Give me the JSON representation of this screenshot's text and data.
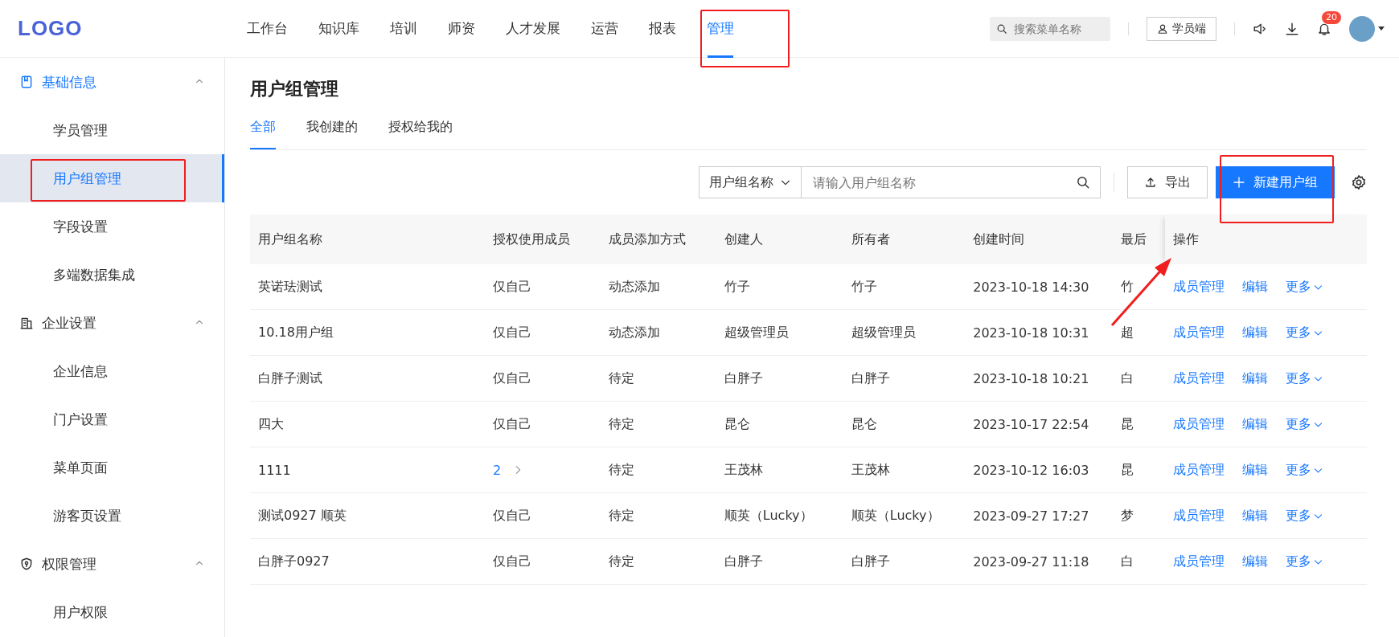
{
  "header": {
    "logo": "LOGO",
    "nav": [
      {
        "label": "工作台",
        "selected": false
      },
      {
        "label": "知识库",
        "selected": false
      },
      {
        "label": "培训",
        "selected": false
      },
      {
        "label": "师资",
        "selected": false
      },
      {
        "label": "人才发展",
        "selected": false
      },
      {
        "label": "运营",
        "selected": false
      },
      {
        "label": "报表",
        "selected": false
      },
      {
        "label": "管理",
        "selected": true
      }
    ],
    "search": {
      "placeholder": "搜索菜单名称"
    },
    "portal_button": "学员端",
    "notification_count": "20"
  },
  "sidebar": {
    "groups": [
      {
        "label": "基础信息",
        "expanded": true,
        "children": [
          {
            "label": "学员管理",
            "selected": false
          },
          {
            "label": "用户组管理",
            "selected": true
          },
          {
            "label": "字段设置",
            "selected": false
          },
          {
            "label": "多端数据集成",
            "selected": false
          }
        ]
      },
      {
        "label": "企业设置",
        "expanded": true,
        "children": [
          {
            "label": "企业信息",
            "selected": false
          },
          {
            "label": "门户设置",
            "selected": false
          },
          {
            "label": "菜单页面",
            "selected": false
          },
          {
            "label": "游客页设置",
            "selected": false
          }
        ]
      },
      {
        "label": "权限管理",
        "expanded": true,
        "children": [
          {
            "label": "用户权限",
            "selected": false
          }
        ]
      }
    ]
  },
  "page": {
    "title": "用户组管理",
    "tabs": [
      {
        "label": "全部",
        "selected": true
      },
      {
        "label": "我创建的",
        "selected": false
      },
      {
        "label": "授权给我的",
        "selected": false
      }
    ],
    "filter": {
      "field": "用户组名称",
      "placeholder": "请输入用户组名称"
    },
    "export_button": "导出",
    "create_button": "新建用户组"
  },
  "table": {
    "columns": [
      "用户组名称",
      "授权使用成员",
      "成员添加方式",
      "创建人",
      "所有者",
      "创建时间",
      "最后",
      "操作"
    ],
    "rows": [
      {
        "name": "英诺珐测试",
        "members": {
          "kind": "text",
          "text": "仅自己"
        },
        "add_method": "动态添加",
        "creator": "竹子",
        "owner": "竹子",
        "created": "2023-10-18 14:30",
        "last": "竹",
        "actions": [
          "成员管理",
          "编辑",
          "更多"
        ]
      },
      {
        "name": "10.18用户组",
        "members": {
          "kind": "text",
          "text": "仅自己"
        },
        "add_method": "动态添加",
        "creator": "超级管理员",
        "owner": "超级管理员",
        "created": "2023-10-18 10:31",
        "last": "超",
        "actions": [
          "成员管理",
          "编辑",
          "更多"
        ]
      },
      {
        "name": "白胖子测试",
        "members": {
          "kind": "text",
          "text": "仅自己"
        },
        "add_method": "待定",
        "creator": "白胖子",
        "owner": "白胖子",
        "created": "2023-10-18 10:21",
        "last": "白",
        "actions": [
          "成员管理",
          "编辑",
          "更多"
        ]
      },
      {
        "name": "四大",
        "members": {
          "kind": "text",
          "text": "仅自己"
        },
        "add_method": "待定",
        "creator": "昆仑",
        "owner": "昆仑",
        "created": "2023-10-17 22:54",
        "last": "昆",
        "actions": [
          "成员管理",
          "编辑",
          "更多"
        ]
      },
      {
        "name": "1111",
        "members": {
          "kind": "link",
          "text": "2"
        },
        "add_method": "待定",
        "creator": "王茂林",
        "owner": "王茂林",
        "created": "2023-10-12 16:03",
        "last": "昆",
        "actions": [
          "成员管理",
          "编辑",
          "更多"
        ]
      },
      {
        "name": "测试0927 顺英",
        "members": {
          "kind": "text",
          "text": "仅自己"
        },
        "add_method": "待定",
        "creator": "顺英（Lucky）",
        "owner": "顺英（Lucky）",
        "created": "2023-09-27 17:27",
        "last": "梦",
        "actions": [
          "成员管理",
          "编辑",
          "更多"
        ]
      },
      {
        "name": "白胖子0927",
        "members": {
          "kind": "text",
          "text": "仅自己"
        },
        "add_method": "待定",
        "creator": "白胖子",
        "owner": "白胖子",
        "created": "2023-09-27 11:18",
        "last": "白",
        "actions": [
          "成员管理",
          "编辑",
          "更多"
        ]
      }
    ]
  }
}
